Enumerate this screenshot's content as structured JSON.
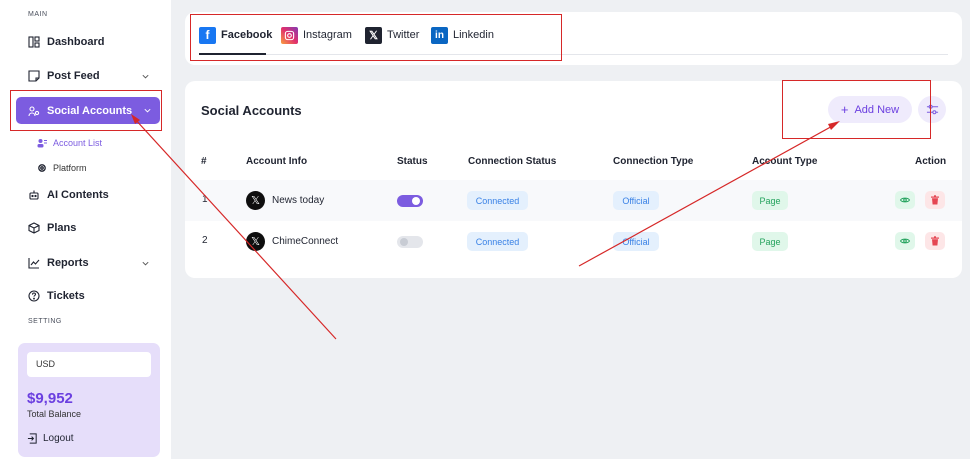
{
  "sidebar": {
    "section_main": "MAIN",
    "section_setting": "SETTING",
    "items": [
      {
        "label": "Dashboard",
        "icon": "dashboard-icon"
      },
      {
        "label": "Post Feed",
        "icon": "post-feed-icon"
      },
      {
        "label": "Social Accounts",
        "icon": "social-accounts-icon"
      },
      {
        "label": "AI Contents",
        "icon": "robot-icon"
      },
      {
        "label": "Plans",
        "icon": "box-icon"
      },
      {
        "label": "Reports",
        "icon": "chart-line-icon"
      },
      {
        "label": "Tickets",
        "icon": "help-circle-icon"
      }
    ],
    "sub_items": [
      {
        "label": "Account List",
        "icon": "users-icon"
      },
      {
        "label": "Platform",
        "icon": "gear-icon"
      }
    ],
    "balance": {
      "currency": "USD",
      "amount": "$9,952",
      "label": "Total Balance",
      "logout": "Logout"
    }
  },
  "platform_tabs": [
    {
      "label": "Facebook",
      "icon": "facebook-icon",
      "active": true
    },
    {
      "label": "Instagram",
      "icon": "instagram-icon"
    },
    {
      "label": "Twitter",
      "icon": "x-twitter-icon"
    },
    {
      "label": "Linkedin",
      "icon": "linkedin-icon"
    }
  ],
  "accounts": {
    "title": "Social Accounts",
    "add_label": "Add New",
    "columns": [
      "#",
      "Account Info",
      "Status",
      "Connection Status",
      "Connection Type",
      "Account Type",
      "Action"
    ],
    "rows": [
      {
        "index": "1",
        "name": "News today",
        "status_on": true,
        "connection_status": "Connected",
        "connection_type": "Official",
        "account_type": "Page"
      },
      {
        "index": "2",
        "name": "ChimeConnect",
        "status_on": false,
        "connection_status": "Connected",
        "connection_type": "Official",
        "account_type": "Page"
      }
    ]
  },
  "colors": {
    "accent": "#7c5ce0",
    "annotation": "#d62828",
    "connected": "#3a82e6",
    "page_badge": "#25a35e",
    "delete": "#e54552"
  }
}
